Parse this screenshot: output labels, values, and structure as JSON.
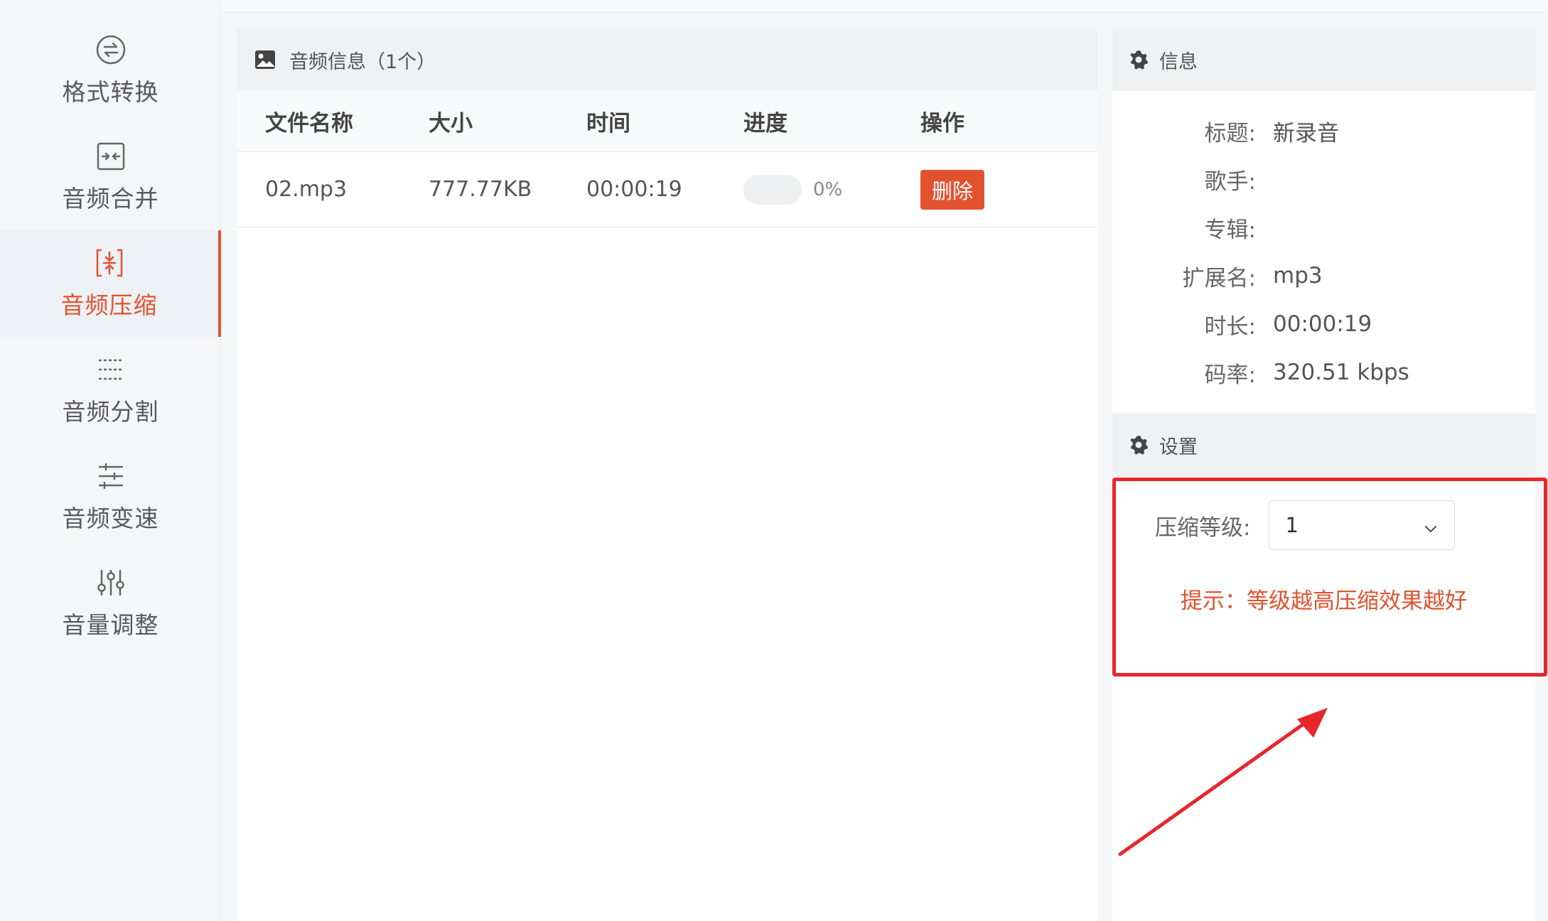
{
  "sidebar": {
    "items": [
      {
        "label": "格式转换",
        "icon": "format-convert-icon"
      },
      {
        "label": "音频合并",
        "icon": "merge-icon"
      },
      {
        "label": "音频压缩",
        "icon": "compress-icon",
        "active": true
      },
      {
        "label": "音频分割",
        "icon": "split-icon"
      },
      {
        "label": "音频变速",
        "icon": "speed-icon"
      },
      {
        "label": "音量调整",
        "icon": "volume-icon"
      }
    ]
  },
  "main": {
    "header_title": "音频信息（1个）",
    "columns": [
      "文件名称",
      "大小",
      "时间",
      "进度",
      "操作"
    ],
    "rows": [
      {
        "name": "02.mp3",
        "size": "777.77KB",
        "time": "00:00:19",
        "progress_text": "0%",
        "progress": 0,
        "action": "删除"
      }
    ]
  },
  "info": {
    "header": "信息",
    "fields": [
      {
        "key": "标题:",
        "value": "新录音"
      },
      {
        "key": "歌手:",
        "value": ""
      },
      {
        "key": "专辑:",
        "value": ""
      },
      {
        "key": "扩展名:",
        "value": "mp3"
      },
      {
        "key": "时长:",
        "value": "00:00:19"
      },
      {
        "key": "码率:",
        "value": "320.51 kbps"
      }
    ]
  },
  "settings": {
    "header": "设置",
    "compression_label": "压缩等级:",
    "compression_value": "1",
    "tip": "提示：等级越高压缩效果越好"
  },
  "colors": {
    "accent": "#e2522f",
    "highlight": "#e8262b"
  }
}
